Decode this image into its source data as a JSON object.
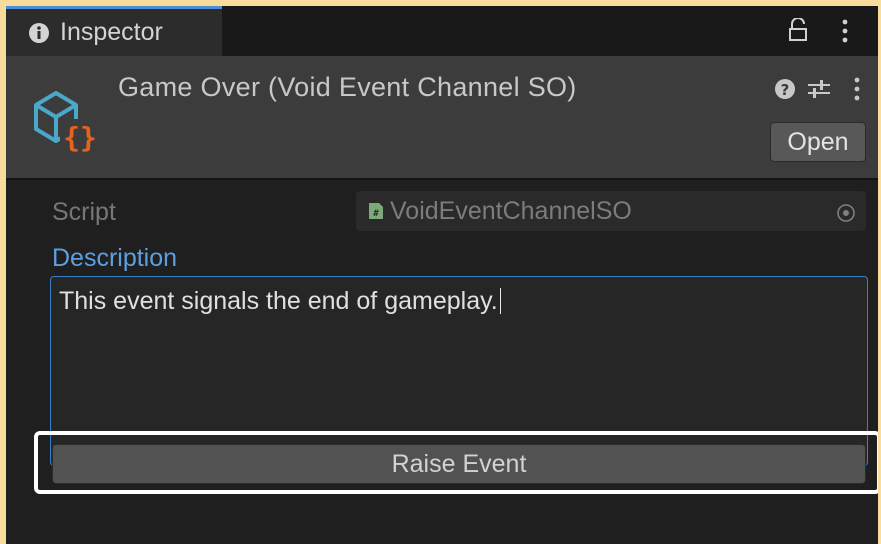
{
  "tab": {
    "label": "Inspector",
    "icon": "info-icon",
    "lock_icon": "lock-icon",
    "menu_icon": "kebab-menu-icon"
  },
  "header": {
    "title": "Game Over (Void Event Channel SO)",
    "asset_icon": "scriptable-object-icon",
    "help_icon": "help-icon",
    "presets_icon": "presets-icon",
    "menu_icon": "kebab-menu-icon",
    "open_label": "Open"
  },
  "fields": {
    "script_label": "Script",
    "script_value": "VoidEventChannelSO",
    "script_icon": "cs-script-icon",
    "picker_icon": "object-picker-icon",
    "description_label": "Description",
    "description_value": "This event signals the end of gameplay."
  },
  "actions": {
    "raise_label": "Raise Event"
  },
  "colors": {
    "accent": "#3a7fc7",
    "label_blue": "#5d9fe0",
    "icon_teal": "#4aa8c8",
    "icon_orange": "#e8621e",
    "highlight": "#ffffff"
  }
}
